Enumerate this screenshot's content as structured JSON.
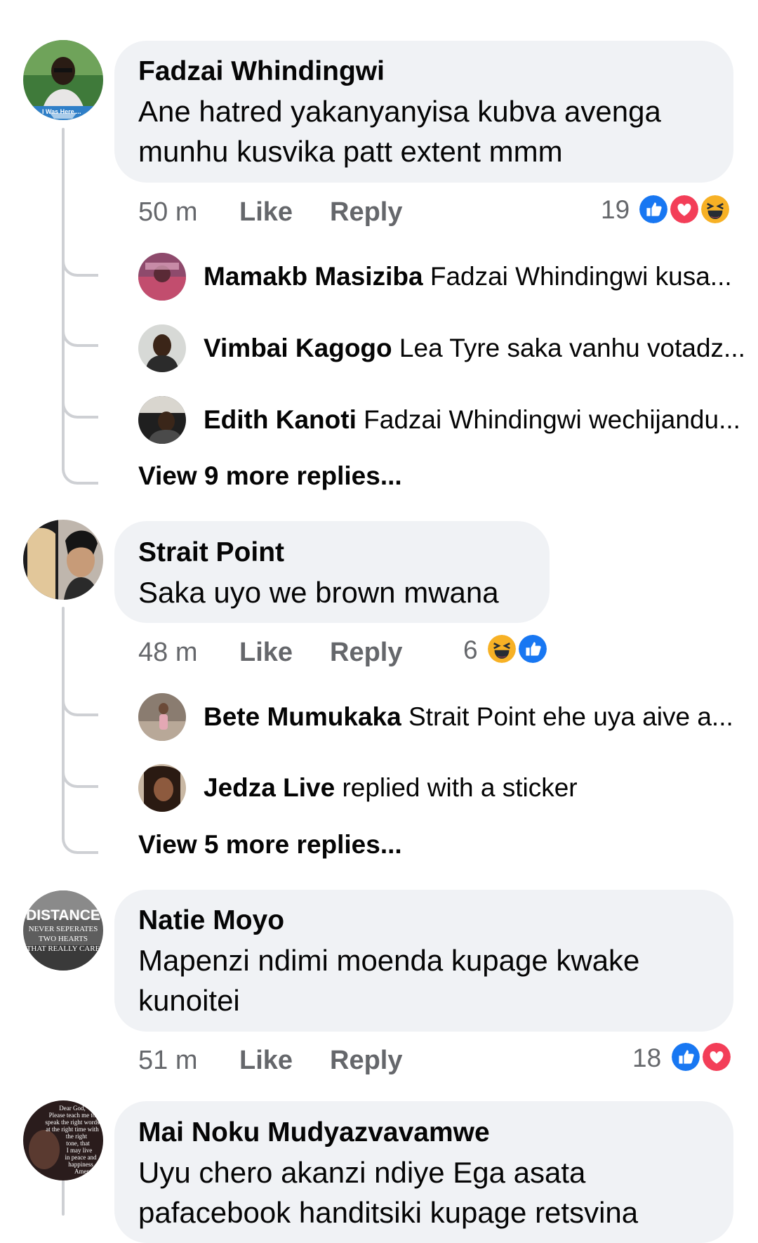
{
  "comments": [
    {
      "author": "Fadzai Whindingwi",
      "text_line1": "Ane hatred yakanyanyisa kubva avenga",
      "text_line2": "munhu kusvika patt extent mmm",
      "time": "50 m",
      "like_label": "Like",
      "reply_label": "Reply",
      "reaction_count": "19",
      "reactions": [
        "like-icon",
        "love-icon",
        "haha-icon"
      ],
      "avatar_caption": "I Was Here....",
      "replies": [
        {
          "author": "Mamakb Masiziba",
          "text": "Fadzai Whindingwi kusa..."
        },
        {
          "author": "Vimbai Kagogo",
          "text": "Lea Tyre saka vanhu votadz..."
        },
        {
          "author": "Edith Kanoti",
          "text": "Fadzai Whindingwi wechijandu..."
        }
      ],
      "view_more": "View 9 more replies..."
    },
    {
      "author": "Strait Point",
      "text_line1": "Saka uyo we brown mwana",
      "time": "48 m",
      "like_label": "Like",
      "reply_label": "Reply",
      "reaction_count": "6",
      "reactions": [
        "haha-icon",
        "like-icon"
      ],
      "replies": [
        {
          "author": "Bete Mumukaka",
          "text": "Strait Point ehe uya aive a..."
        },
        {
          "author": "Jedza Live",
          "text": "replied with a sticker"
        }
      ],
      "view_more": "View 5 more replies..."
    },
    {
      "author": "Natie Moyo",
      "text_line1": "Mapenzi ndimi moenda kupage kwake",
      "text_line2": "kunoitei",
      "time": "51 m",
      "like_label": "Like",
      "reply_label": "Reply",
      "reaction_count": "18",
      "reactions": [
        "like-icon",
        "love-icon"
      ],
      "avatar_text": [
        "DISTANCE",
        "NEVER SEPERATES",
        "TWO HEARTS",
        "THAT REALLY CARE"
      ]
    },
    {
      "author": "Mai Noku Mudyazvavamwe",
      "text_line1": "Uyu chero akanzi ndiye Ega asata",
      "text_line2": "pafacebook handitsiki kupage retsvina",
      "avatar_text": [
        "Dear God,",
        "Please teach me to",
        "speak the right words",
        "at the right time with",
        "the right",
        "tone, that",
        "I may live",
        "in peace and",
        "happiness",
        "Amen"
      ]
    }
  ],
  "colors": {
    "bubble": "#f0f2f5",
    "meta_text": "#65676b",
    "thread_line": "#ced0d4",
    "like_blue": "#1877f2",
    "love_red": "#f33e58",
    "haha_yellow": "#f7b125"
  }
}
